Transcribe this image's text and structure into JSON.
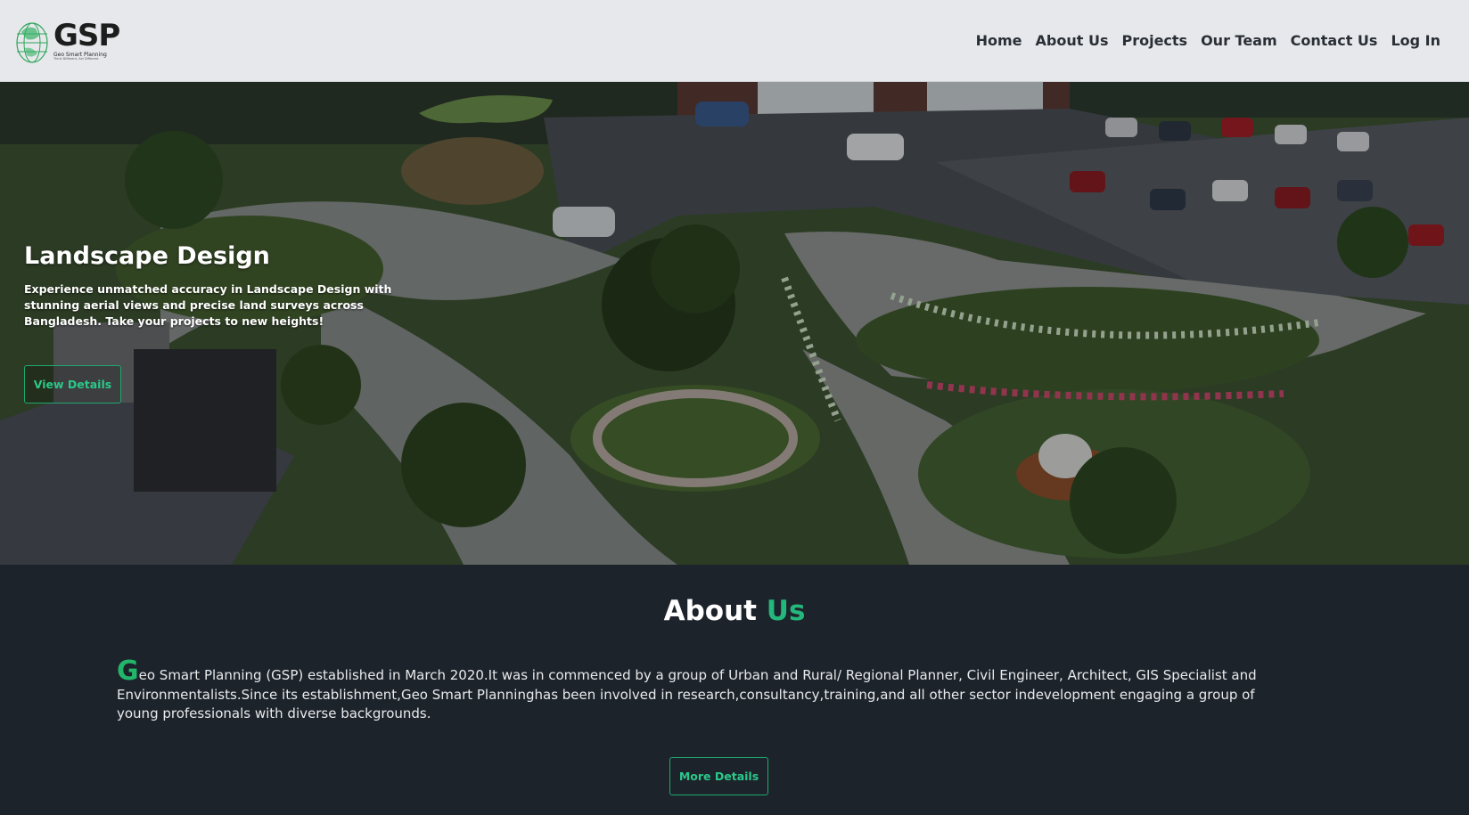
{
  "header": {
    "logo": {
      "mark": "GSP",
      "name": "Geo Smart Planning",
      "tagline": "Think Different, Act Different"
    },
    "nav": [
      "Home",
      "About Us",
      "Projects",
      "Our Team",
      "Contact Us",
      "Log In"
    ]
  },
  "hero": {
    "title": "Landscape Design",
    "text": "Experience unmatched accuracy in Landscape Design with stunning aerial views and precise land surveys across Bangladesh. Take your projects to new heights!",
    "button": "View Details"
  },
  "about": {
    "heading_white": "About",
    "heading_green": "Us",
    "drop_letter": "G",
    "paragraph": "eo Smart Planning (GSP) established in March 2020.It was in commenced by a group of Urban and Rural/ Regional Planner, Civil Engineer, Architect, GIS Specialist and Environmentalists.Since its establishment,Geo Smart Planninghas been involved in research,consultancy,training,and all other sector indevelopment engaging a group of young professionals with diverse backgrounds.",
    "button": "More Details"
  },
  "colors": {
    "accent": "#24b77c",
    "header_bg": "#e6e8eb",
    "page_bg": "#1d232b"
  }
}
